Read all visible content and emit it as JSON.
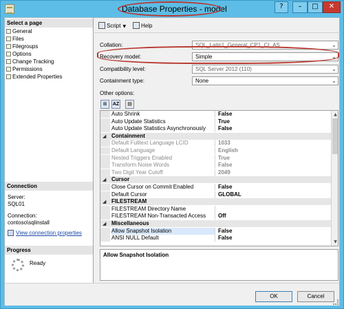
{
  "window": {
    "title": "Database Properties - model",
    "buttons": [
      "?",
      "–",
      "□",
      "✕"
    ]
  },
  "left_pane": {
    "select_page_header": "Select a page",
    "pages": [
      "General",
      "Files",
      "Filegroups",
      "Options",
      "Change Tracking",
      "Permissions",
      "Extended Properties"
    ],
    "connection_header": "Connection",
    "server_label": "Server:",
    "server_value": "SQL01",
    "connection_label": "Connection:",
    "connection_value": "contoso\\sqlinstall",
    "view_connection_link": "View connection properties",
    "progress_header": "Progress",
    "progress_status": "Ready"
  },
  "toolbar": {
    "script_label": "Script",
    "help_label": "Help"
  },
  "form": {
    "collation_label": "Collation:",
    "collation_value": "SQL_Latin1_General_CP1_CI_AS",
    "recovery_label": "Recovery model:",
    "recovery_value": "Simple",
    "compat_label": "Compatibility level:",
    "compat_value": "SQL Server 2012 (110)",
    "containment_label": "Containment type:",
    "containment_value": "None",
    "other_options_label": "Other options:"
  },
  "grid": {
    "rows": [
      {
        "kind": "prop",
        "name": "Auto Shrink",
        "value": "False"
      },
      {
        "kind": "prop",
        "name": "Auto Update Statistics",
        "value": "True"
      },
      {
        "kind": "prop",
        "name": "Auto Update Statistics Asynchronously",
        "value": "False"
      },
      {
        "kind": "cat",
        "name": "Containment"
      },
      {
        "kind": "gray",
        "name": "Default Fulltext Language LCID",
        "value": "1033"
      },
      {
        "kind": "gray",
        "name": "Default Language",
        "value": "English"
      },
      {
        "kind": "gray",
        "name": "Nested Triggers Enabled",
        "value": "True"
      },
      {
        "kind": "gray",
        "name": "Transform Noise Words",
        "value": "False"
      },
      {
        "kind": "gray",
        "name": "Two Digit Year Cutoff",
        "value": "2049"
      },
      {
        "kind": "cat",
        "name": "Cursor"
      },
      {
        "kind": "prop",
        "name": "Close Cursor on Commit Enabled",
        "value": "False"
      },
      {
        "kind": "prop",
        "name": "Default Cursor",
        "value": "GLOBAL"
      },
      {
        "kind": "cat",
        "name": "FILESTREAM"
      },
      {
        "kind": "prop",
        "name": "FILESTREAM Directory Name",
        "value": ""
      },
      {
        "kind": "prop",
        "name": "FILESTREAM Non-Transacted Access",
        "value": "Off"
      },
      {
        "kind": "cat",
        "name": "Miscellaneous"
      },
      {
        "kind": "sel",
        "name": "Allow Snapshot Isolation",
        "value": "False"
      },
      {
        "kind": "prop",
        "name": "ANSI NULL Default",
        "value": "False"
      }
    ]
  },
  "description": "Allow Snapshot Isolation",
  "footer": {
    "ok_label": "OK",
    "cancel_label": "Cancel"
  }
}
